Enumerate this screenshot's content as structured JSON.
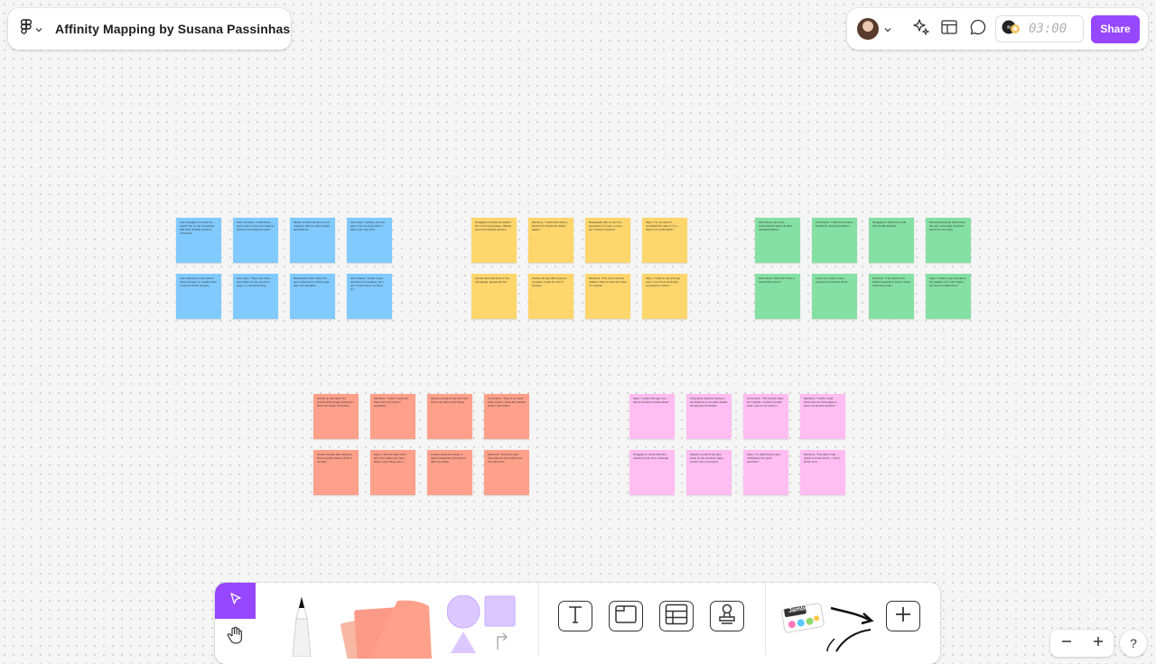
{
  "header": {
    "file_title": "Affinity Mapping by Susana Passinhas"
  },
  "topbar": {
    "timer": "03:00",
    "share_label": "Share"
  },
  "colors": {
    "accent": "#9747ff",
    "blue": "#80caff",
    "yellow": "#ffd66b",
    "green": "#85e0a3",
    "red": "#ffa08a",
    "pink": "#ffbdf2"
  },
  "notes": {
    "blue": [
      "User struggles to locate the search bar on the homepage with links dividing sections unnoticed.",
      "User mentions, \"I wish there was a way to save my progress without completing the task.\"",
      "Mobile version has text cut off making it hard to read product descriptions.",
      "User says, \"I always use this app in the evenings when I have more free time.\"",
      "User attempts to use search terms but gets no results when it doesn't match properly.",
      "User says, \"There are many information on the previous page, I'm overwhelming.\"",
      "Repeatedly clicks 'Help' but gets redirected to a FAQ page they find unhelpful.",
      "User shares, \"I'd like to get reminders for updates, but I don't know how to set them up.\""
    ],
    "yellow": [
      "Struggles to locate the search bar on the homepage, clicking several unrelated sections.",
      "Mentions, \"I wish there was a shortcut to frequently visited pages.\"",
      "Repeatedly taps on an icon expecting it to open a menu, but it doesn't respond.",
      "Says, \"I'm not sure if I completed the task or not — there's no confirmation.\"",
      "Scrolls back and forth on the homepage, appearing lost.",
      "Closes the app after trying to complete a task for over 5 minutes.",
      "Mentions, \"The color contrast makes it hard to read text when I'm outside.\"",
      "Says, \"I'd like to use this app more, but it feels confusing compared to others.\""
    ],
    "green": [
      "Attempts to use voice command but gives up after repeated failures.",
      "Comments, \"I wish there was a tutorial for using this feature.\"",
      "Struggles to find how to edit their profile settings.",
      "Pauses frequently while using the app, seemingly uncertain about the next step.",
      "Asks aloud, \"Why isn't there a back button here?\"",
      "Looks for a way to save progress but doesn't find it.",
      "Mentions, \"The search isn't helpful because it doesn't show what they mean.\"",
      "Says, \"I'd like to get reminders for updates, but I can't figure out how to enable them.\""
    ],
    "red": [
      "Scrolls up and down the product listing page looking for filters but doesn't find them.",
      "Mentions, \"I wish I could sort these items by price or popularity.\"",
      "Selects a product but can't find how to go back to the listing.",
      "Comments, \"There's so much white space; it feels like wasted screen real estate.\"",
      "Closes the app after failing to find a specific feature within 2 minutes.",
      "Says, \"I like the idea of the app, but it takes too many steps to get things done.\"",
      "Leaves sentences when a page navigations and doesn't take any action.",
      "Mentions, \"If only the app remembered my preferences from last time.\""
    ],
    "pink": [
      "Says, \"I prefer this app over others because it loads faster.\"",
      "Frequently switches between descriptions to compare details but appears frustrated.",
      "Comments, \"The tutorial video isn't helpful—it doesn't match what I see on my screen.\"",
      "Mentions, \"I wish I could customize the homepage to show my favorite sections.\"",
      "Struggles to understand the meaning of an error message.",
      "Selects a product but gets stuck on the checkout page, unsure how to proceed.",
      "Says, \"I'm glad that the app notifications for good searches.\"",
      "Mentions, \"The dark mode option is a nice touch—I use it all the time.\""
    ]
  },
  "toolbar": {
    "sticker_label": "Jambot"
  }
}
